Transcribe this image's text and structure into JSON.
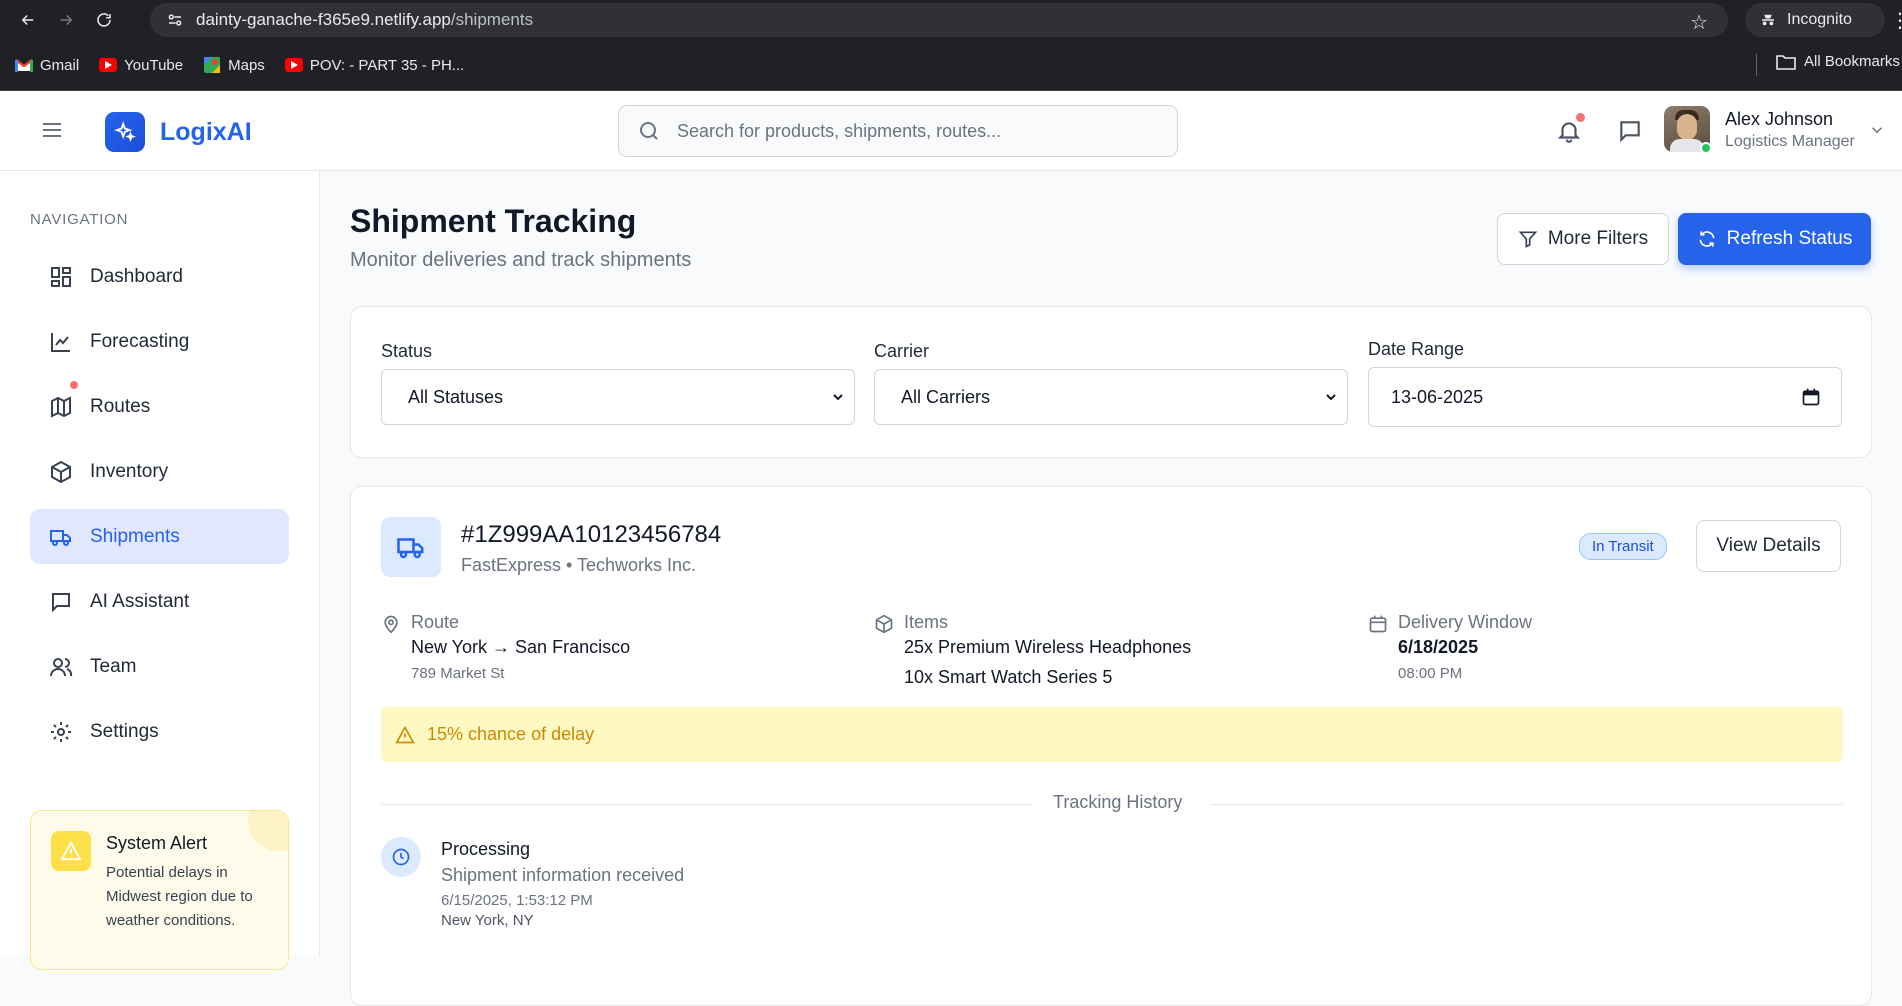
{
  "browser": {
    "url_host": "dainty-ganache-f365e9.netlify.app",
    "url_path": "/shipments",
    "incognito_label": "Incognito",
    "bookmarks": [
      {
        "label": "Gmail",
        "icon": "gmail-icon",
        "color": "#ea4335"
      },
      {
        "label": "YouTube",
        "icon": "youtube-icon",
        "color": "#ff0000"
      },
      {
        "label": "Maps",
        "icon": "maps-icon",
        "color": "#34a853"
      },
      {
        "label": "POV: - PART 35 - PH...",
        "icon": "youtube-icon",
        "color": "#ff0000"
      }
    ],
    "all_bookmarks": "All Bookmarks"
  },
  "header": {
    "brand": "LogixAI",
    "search_placeholder": "Search for products, shipments, routes...",
    "user_name": "Alex Johnson",
    "user_role": "Logistics Manager"
  },
  "sidebar": {
    "title": "NAVIGATION",
    "items": [
      {
        "label": "Dashboard",
        "icon": "dashboard-icon"
      },
      {
        "label": "Forecasting",
        "icon": "chart-line-icon"
      },
      {
        "label": "Routes",
        "icon": "map-icon"
      },
      {
        "label": "Inventory",
        "icon": "box-icon"
      },
      {
        "label": "Shipments",
        "icon": "truck-icon",
        "active": true
      },
      {
        "label": "AI Assistant",
        "icon": "chat-icon"
      },
      {
        "label": "Team",
        "icon": "users-icon"
      },
      {
        "label": "Settings",
        "icon": "gear-icon"
      }
    ],
    "alert": {
      "title": "System Alert",
      "text": "Potential delays in Midwest region due to weather conditions."
    }
  },
  "page": {
    "title": "Shipment Tracking",
    "subtitle": "Monitor deliveries and track shipments",
    "more_filters": "More Filters",
    "refresh": "Refresh Status"
  },
  "filters": {
    "status_label": "Status",
    "status_value": "All Statuses",
    "carrier_label": "Carrier",
    "carrier_value": "All Carriers",
    "date_label": "Date Range",
    "date_value": "13-06-2025"
  },
  "shipment": {
    "id": "#1Z999AA10123456784",
    "carrier_client": "FastExpress • Techworks Inc.",
    "status": "In Transit",
    "view_details": "View Details",
    "route_label": "Route",
    "route": "New York → San Francisco",
    "route_address": "789 Market St",
    "items_label": "Items",
    "items": [
      "25x Premium Wireless Headphones",
      "10x Smart Watch Series 5"
    ],
    "window_label": "Delivery Window",
    "window_date": "6/18/2025",
    "window_time": "08:00 PM",
    "delay": "15% chance of delay",
    "history_title": "Tracking History",
    "history": [
      {
        "status": "Processing",
        "desc": "Shipment information received",
        "time": "6/15/2025, 1:53:12 PM",
        "location": "New York, NY"
      }
    ]
  },
  "colors": {
    "accent": "#2563eb",
    "warning": "#ca8a04",
    "notification": "#f87171",
    "online": "#22c55e"
  }
}
